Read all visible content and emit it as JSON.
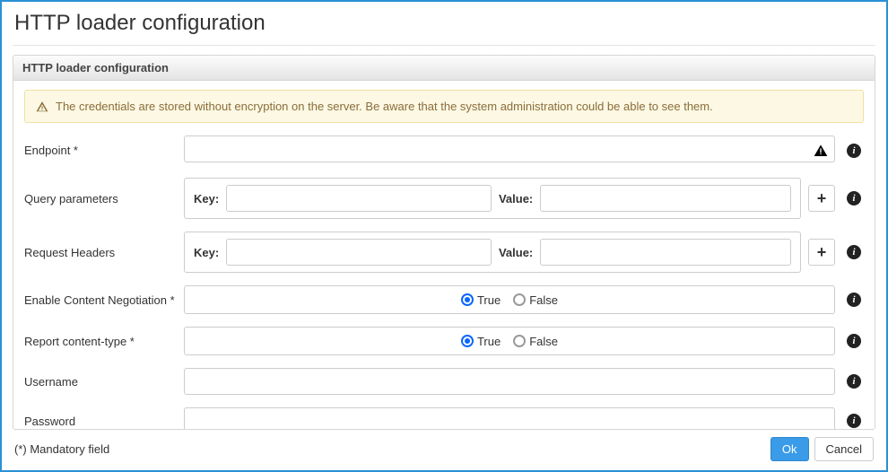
{
  "page": {
    "title": "HTTP loader configuration"
  },
  "panel": {
    "title": "HTTP loader configuration"
  },
  "alert": {
    "text": "The credentials are stored without encryption on the server. Be aware that the system administration could be able to see them."
  },
  "labels": {
    "endpoint": "Endpoint *",
    "query_params": "Query parameters",
    "request_headers": "Request Headers",
    "enable_cn": "Enable Content Negotiation *",
    "report_ct": "Report content-type *",
    "username": "Username",
    "password": "Password",
    "key": "Key:",
    "value": "Value:",
    "true": "True",
    "false": "False"
  },
  "values": {
    "endpoint": "",
    "qp_key": "",
    "qp_value": "",
    "rh_key": "",
    "rh_value": "",
    "username": "",
    "password": ""
  },
  "radios": {
    "enable_cn": "true",
    "report_ct": "true"
  },
  "footer": {
    "mandatory": "(*) Mandatory field",
    "ok": "Ok",
    "cancel": "Cancel"
  },
  "icons": {
    "plus": "+",
    "info": "i"
  }
}
